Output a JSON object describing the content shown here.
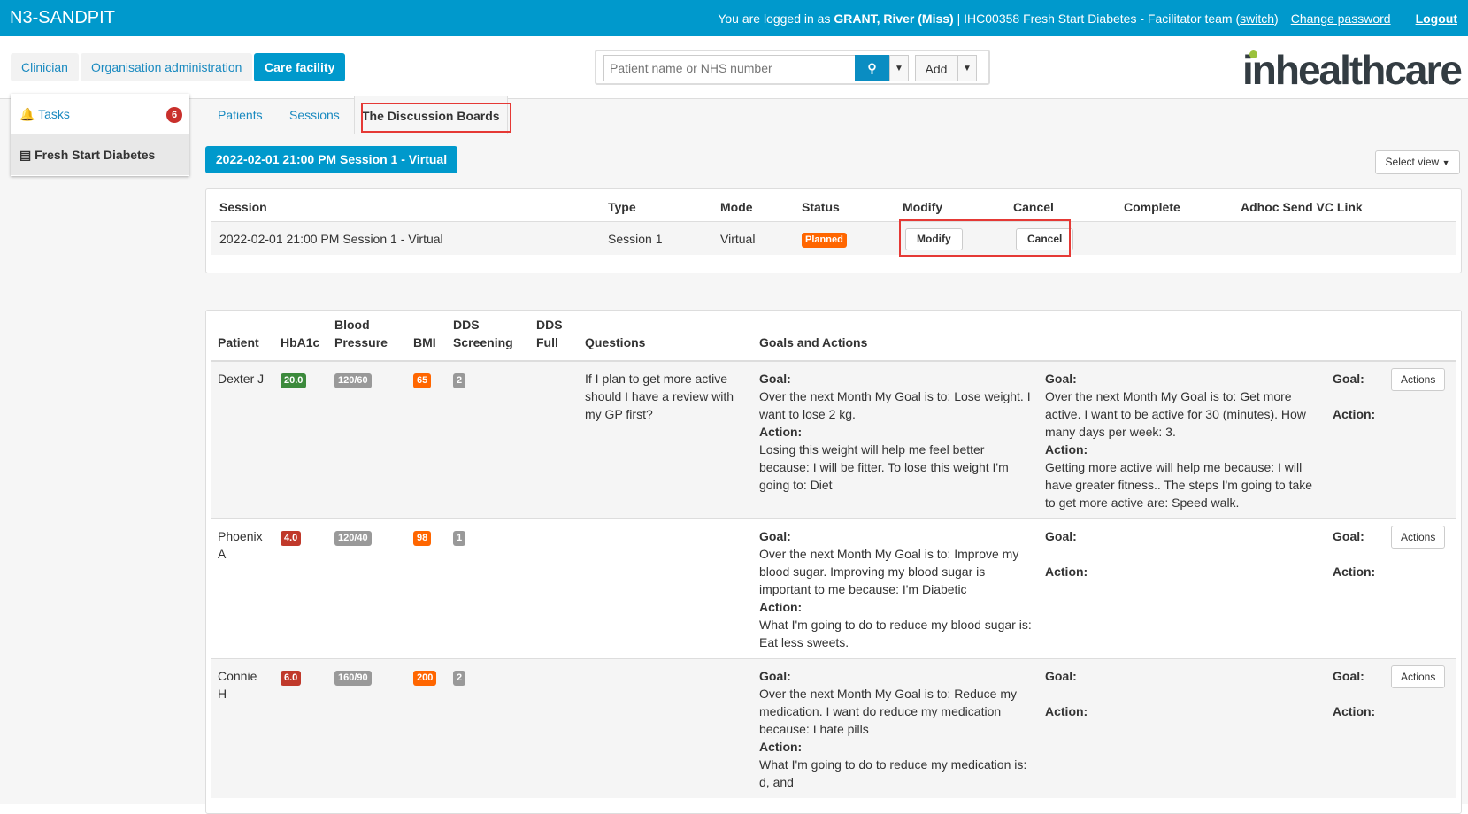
{
  "header": {
    "brand": "N3-SANDPIT",
    "logged_in_prefix": "You are logged in as ",
    "user": "GRANT, River (Miss)",
    "team": " | IHC00358 Fresh Start Diabetes - Facilitator team (",
    "switch": "switch",
    "team_close": ")",
    "change_password": "Change password",
    "logout": "Logout",
    "bg_color": "#0099cc"
  },
  "nav": {
    "items": [
      {
        "label": "Clinician",
        "active": false
      },
      {
        "label": "Organisation administration",
        "active": false
      },
      {
        "label": "Care facility",
        "active": true
      }
    ]
  },
  "search": {
    "placeholder": "Patient name or NHS number",
    "value": "",
    "search_icon": "search-icon",
    "add_label": "Add"
  },
  "logo": "inhealthcare",
  "sidebar": {
    "tasks_label": "Tasks",
    "tasks_count": "6",
    "group_label": "Fresh Start Diabetes"
  },
  "tabs": [
    {
      "label": "Patients"
    },
    {
      "label": "Sessions"
    },
    {
      "label": "The Discussion Boards",
      "active": true
    }
  ],
  "session_title": "2022-02-01 21:00 PM Session 1 - Virtual",
  "select_view": "Select view",
  "session_table": {
    "headers": [
      "Session",
      "Type",
      "Mode",
      "Status",
      "Modify",
      "Cancel",
      "Complete",
      "Adhoc Send VC Link"
    ],
    "row": {
      "session": "2022-02-01 21:00 PM Session 1 - Virtual",
      "type": "Session 1",
      "mode": "Virtual",
      "status": "Planned",
      "status_color": "#ff6600",
      "modify": "Modify",
      "cancel": "Cancel"
    }
  },
  "patients_table": {
    "headers": {
      "patient": "Patient",
      "hba1c": "HbA1c",
      "bp": "Blood Pressure",
      "bmi": "BMI",
      "dds_screening": "DDS Screening",
      "dds_full": "DDS Full",
      "questions": "Questions",
      "goals": "Goals and Actions"
    },
    "goal_label": "Goal:",
    "action_label": "Action:",
    "actions_button": "Actions",
    "rows": [
      {
        "patient": "Dexter J",
        "hba1c": "20.0",
        "hba1c_color": "#3c8a3c",
        "bp": "120/60",
        "bmi": "65",
        "dds": "2",
        "questions": "If I plan to get more active should I have a review with my GP first?",
        "goal1": "Over the next Month My Goal is to: Lose weight. I want to lose 2 kg.",
        "action1": "Losing this weight will help me feel better because: I will be fitter. To lose this weight I'm going to: Diet",
        "goal2": "Over the next Month My Goal is to: Get more active. I want to be active for 30 (minutes). How many days per week: 3.",
        "action2": "Getting more active will help me because: I will have greater fitness.. The steps I'm going to take to get more active are: Speed walk."
      },
      {
        "patient": "Phoenix A",
        "hba1c": "4.0",
        "hba1c_color": "#c0392b",
        "bp": "120/40",
        "bmi": "98",
        "dds": "1",
        "questions": "",
        "goal1": "Over the next Month My Goal is to: Improve my blood sugar. Improving my blood sugar is important to me because: I'm Diabetic",
        "action1": "What I'm going to do to reduce my blood sugar is: Eat less sweets.",
        "goal2": "",
        "action2": ""
      },
      {
        "patient": "Connie H",
        "hba1c": "6.0",
        "hba1c_color": "#c0392b",
        "bp": "160/90",
        "bmi": "200",
        "dds": "2",
        "questions": "",
        "goal1": "Over the next Month My Goal is to: Reduce my medication. I want do reduce my medication because: I hate pills",
        "action1": "What I'm going to do to reduce my medication is: d, and",
        "goal2": "",
        "action2": ""
      }
    ]
  },
  "colors": {
    "bp_badge": "#999999",
    "bmi_badge": "#ff6600",
    "dds_badge": "#999999",
    "highlight": "#e53935"
  }
}
